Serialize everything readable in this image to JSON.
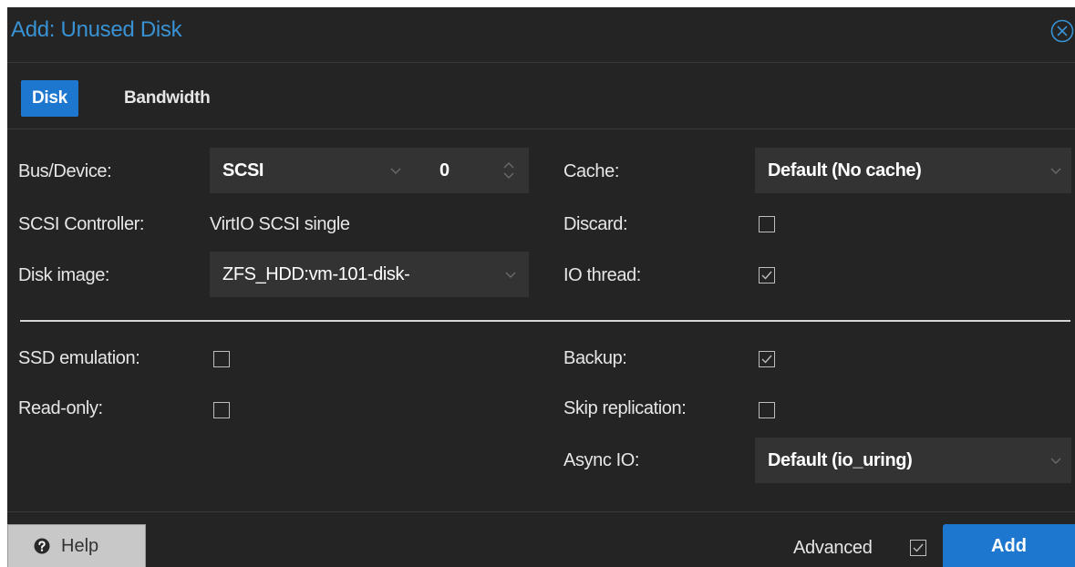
{
  "dialog": {
    "title": "Add: Unused Disk"
  },
  "tabs": [
    {
      "label": "Disk",
      "active": true
    },
    {
      "label": "Bandwidth",
      "active": false
    }
  ],
  "left": {
    "bus_device_label": "Bus/Device:",
    "bus_value": "SCSI",
    "device_number": "0",
    "scsi_controller_label": "SCSI Controller:",
    "scsi_controller_value": "VirtIO SCSI single",
    "disk_image_label": "Disk image:",
    "disk_image_value": "ZFS_HDD:vm-101-disk-",
    "ssd_emulation_label": "SSD emulation:",
    "ssd_emulation_checked": false,
    "read_only_label": "Read-only:",
    "read_only_checked": false
  },
  "right": {
    "cache_label": "Cache:",
    "cache_value": "Default (No cache)",
    "discard_label": "Discard:",
    "discard_checked": false,
    "io_thread_label": "IO thread:",
    "io_thread_checked": true,
    "backup_label": "Backup:",
    "backup_checked": true,
    "skip_replication_label": "Skip replication:",
    "skip_replication_checked": false,
    "async_io_label": "Async IO:",
    "async_io_value": "Default (io_uring)"
  },
  "footer": {
    "help_label": "Help",
    "advanced_label": "Advanced",
    "advanced_checked": true,
    "add_label": "Add"
  },
  "colors": {
    "background": "#242424",
    "field": "#333333",
    "accent": "#1e77cf",
    "title": "#3892d4"
  }
}
